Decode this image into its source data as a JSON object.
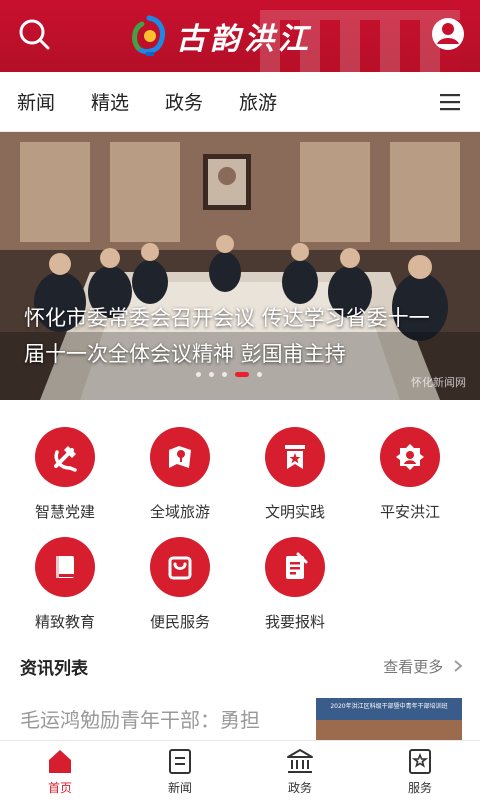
{
  "header": {
    "app_title": "古韵洪江",
    "brand_color": "#c8102e",
    "search_icon": "search-icon",
    "user_icon": "user-avatar-icon"
  },
  "nav": {
    "tabs": [
      {
        "label": "新闻"
      },
      {
        "label": "精选"
      },
      {
        "label": "政务"
      },
      {
        "label": "旅游"
      }
    ],
    "menu_icon": "menu-icon"
  },
  "banner": {
    "headline": "怀化市委常委会召开会议 传达学习省委十一届十一次全体会议精神 彭国甫主持",
    "watermark": "怀化新闻网",
    "slide_count": 5,
    "active_slide": 4
  },
  "services": [
    {
      "label": "智慧党建",
      "icon": "party-emblem-icon"
    },
    {
      "label": "全域旅游",
      "icon": "map-pin-icon"
    },
    {
      "label": "文明实践",
      "icon": "flag-star-icon"
    },
    {
      "label": "平安洪江",
      "icon": "police-badge-icon"
    },
    {
      "label": "精致教育",
      "icon": "book-icon"
    },
    {
      "label": "便民服务",
      "icon": "shopping-bag-icon"
    },
    {
      "label": "我要报料",
      "icon": "report-document-icon"
    }
  ],
  "news_section": {
    "title": "资讯列表",
    "more_label": "查看更多",
    "items": [
      {
        "title": "毛运鸿勉励青年干部：勇担",
        "thumb_caption": "2020年洪江区科级干部暨中青年干部培训班"
      }
    ]
  },
  "tabbar": {
    "items": [
      {
        "label": "首页",
        "icon": "home-icon",
        "active": true
      },
      {
        "label": "新闻",
        "icon": "news-icon",
        "active": false
      },
      {
        "label": "政务",
        "icon": "government-building-icon",
        "active": false
      },
      {
        "label": "服务",
        "icon": "service-icon",
        "active": false
      }
    ],
    "active_color": "#d71e2f"
  }
}
